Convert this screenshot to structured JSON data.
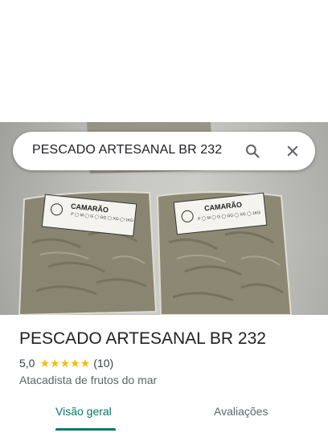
{
  "search": {
    "query": "PESCADO ARTESANAL BR 232",
    "search_icon": "search-icon",
    "close_icon": "close-icon"
  },
  "photo": {
    "label_left": "CAMARÃO",
    "label_right": "CAMARÃO",
    "label_sizes": "P ◯ M ◯ G ◯ GG ◯ XG ◯",
    "label_weight": "1KG"
  },
  "place": {
    "title": "PESCADO ARTESANAL BR 232",
    "rating": "5,0",
    "star_count": 5,
    "review_count": "(10)",
    "category": "Atacadista de frutos do mar"
  },
  "tabs": [
    {
      "label": "Visão geral",
      "active": true
    },
    {
      "label": "Avaliações",
      "active": false
    }
  ],
  "colors": {
    "accent": "#00796b",
    "star": "#fbbc04"
  }
}
